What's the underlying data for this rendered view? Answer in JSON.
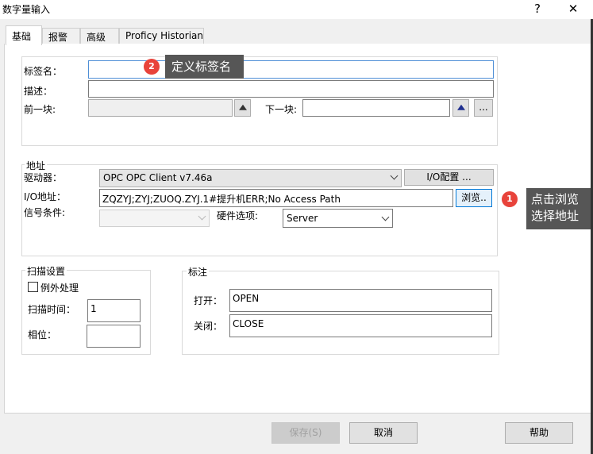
{
  "window": {
    "title": "数字量输入",
    "help_glyph": "?",
    "close_glyph": "✕"
  },
  "tabs": [
    {
      "label": "基础"
    },
    {
      "label": "报警"
    },
    {
      "label": "高级"
    },
    {
      "label": "Proficy Historian"
    }
  ],
  "basic": {
    "tag_label": "标签名：",
    "tag_value": "",
    "desc_label": "描述：",
    "desc_value": "",
    "prev_label": "前一块:",
    "prev_value": "",
    "next_label": "下一块:",
    "next_value": "",
    "more_glyph": "..."
  },
  "address": {
    "group_title": "地址",
    "driver_label": "驱动器：",
    "driver_value": "OPC    OPC Client v7.46a",
    "io_config_label": "I/O配置 ...",
    "io_address_label": "I/O地址：",
    "io_address_value": "ZQZYJ;ZYJ;ZUOQ.ZYJ.1#提升机ERR;No Access Path",
    "browse_label": "浏览..",
    "signal_label": "信号条件:",
    "signal_value": "",
    "hw_label": "硬件选项:",
    "hw_value": "Server"
  },
  "scan": {
    "group_title": "扫描设置",
    "exception_label": "例外处理",
    "scan_time_label": "扫描时间：",
    "scan_time_value": "1",
    "phase_label": "相位：",
    "phase_value": ""
  },
  "labels_group": {
    "group_title": "标注",
    "open_label": "打开：",
    "open_value": "OPEN",
    "close_label": "关闭：",
    "close_value": "CLOSE"
  },
  "footer": {
    "save_label": "保存(S)",
    "cancel_label": "取消",
    "help_label": "帮助"
  },
  "annotations": {
    "badge1": "1",
    "note1_line1": "点击浏览",
    "note1_line2": "选择地址",
    "badge2": "2",
    "note2": "定义标签名"
  },
  "colors": {
    "badge": "#e8433b",
    "tooltip_bg": "#565656",
    "focus_border": "#4f8fd6"
  }
}
